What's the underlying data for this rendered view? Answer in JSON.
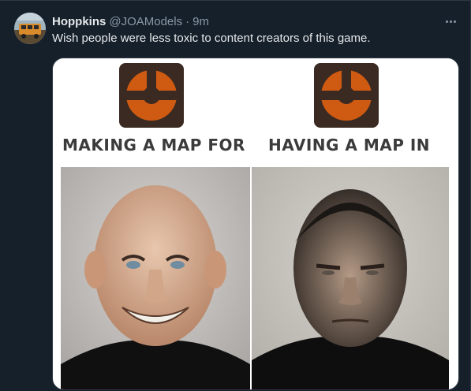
{
  "tweet": {
    "display_name": "Hoppkins",
    "handle": "@JOAModels",
    "separator": "·",
    "time": "9m",
    "text": "Wish people were less toxic to content creators of this game."
  },
  "media": {
    "left_caption": "MAKING A MAP FOR",
    "right_caption": "HAVING A MAP IN"
  },
  "icons": {
    "more": "more-options-icon",
    "game_logo": "tf2-logo-icon"
  },
  "colors": {
    "background": "#15202b",
    "primary_text": "#e7e9ea",
    "secondary_text": "#8b98a5",
    "logo_orange": "#cf5a12",
    "logo_dark": "#3a2a22"
  }
}
